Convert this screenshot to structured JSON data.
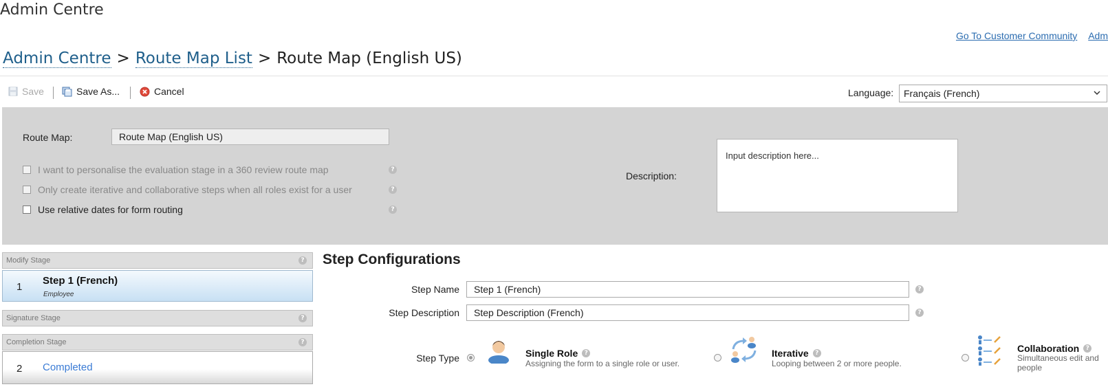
{
  "app": {
    "title": "Admin Centre"
  },
  "top_links": [
    "Go To Customer Community",
    "Adm"
  ],
  "breadcrumb": {
    "home": "Admin Centre",
    "list": "Route Map List",
    "sep": ">",
    "current": "Route Map (English US)"
  },
  "toolbar": {
    "save_label": "Save",
    "save_as_label": "Save As...",
    "cancel_label": "Cancel",
    "language_label": "Language:",
    "language_value": "Français (French)"
  },
  "form": {
    "route_map_label": "Route Map:",
    "route_map_value": "Route Map (English US)",
    "options": [
      {
        "label": "I want to personalise the evaluation stage in a 360 review route map",
        "enabled": false
      },
      {
        "label": "Only create iterative and collaborative steps when all roles exist for a user",
        "enabled": false
      },
      {
        "label": "Use relative dates for form routing",
        "enabled": true
      }
    ],
    "description_label": "Description:",
    "description_placeholder": "Input description here..."
  },
  "stages": {
    "modify": {
      "header": "Modify Stage",
      "step_number": "1",
      "step_name": "Step 1 (French)",
      "step_role": "Employee"
    },
    "signature": {
      "header": "Signature Stage"
    },
    "completion": {
      "header": "Completion Stage",
      "step_number": "2",
      "step_name": "Completed"
    }
  },
  "step_config": {
    "title": "Step Configurations",
    "step_name_label": "Step Name",
    "step_name_value": "Step 1 (French)",
    "step_description_label": "Step Description",
    "step_description_value": "Step Description (French)",
    "step_type_label": "Step Type",
    "types": [
      {
        "title": "Single Role",
        "desc": "Assigning the form to a single role or user.",
        "selected": true
      },
      {
        "title": "Iterative",
        "desc": "Looping between 2 or more people.",
        "selected": false
      },
      {
        "title": "Collaboration",
        "desc1": "Simultaneous edit and",
        "desc2": "people",
        "selected": false
      }
    ]
  },
  "help_glyph": "?",
  "colors": {
    "link": "#1f5f8b",
    "panel": "#d4d4d4",
    "active_step": "#c8e0f4"
  }
}
